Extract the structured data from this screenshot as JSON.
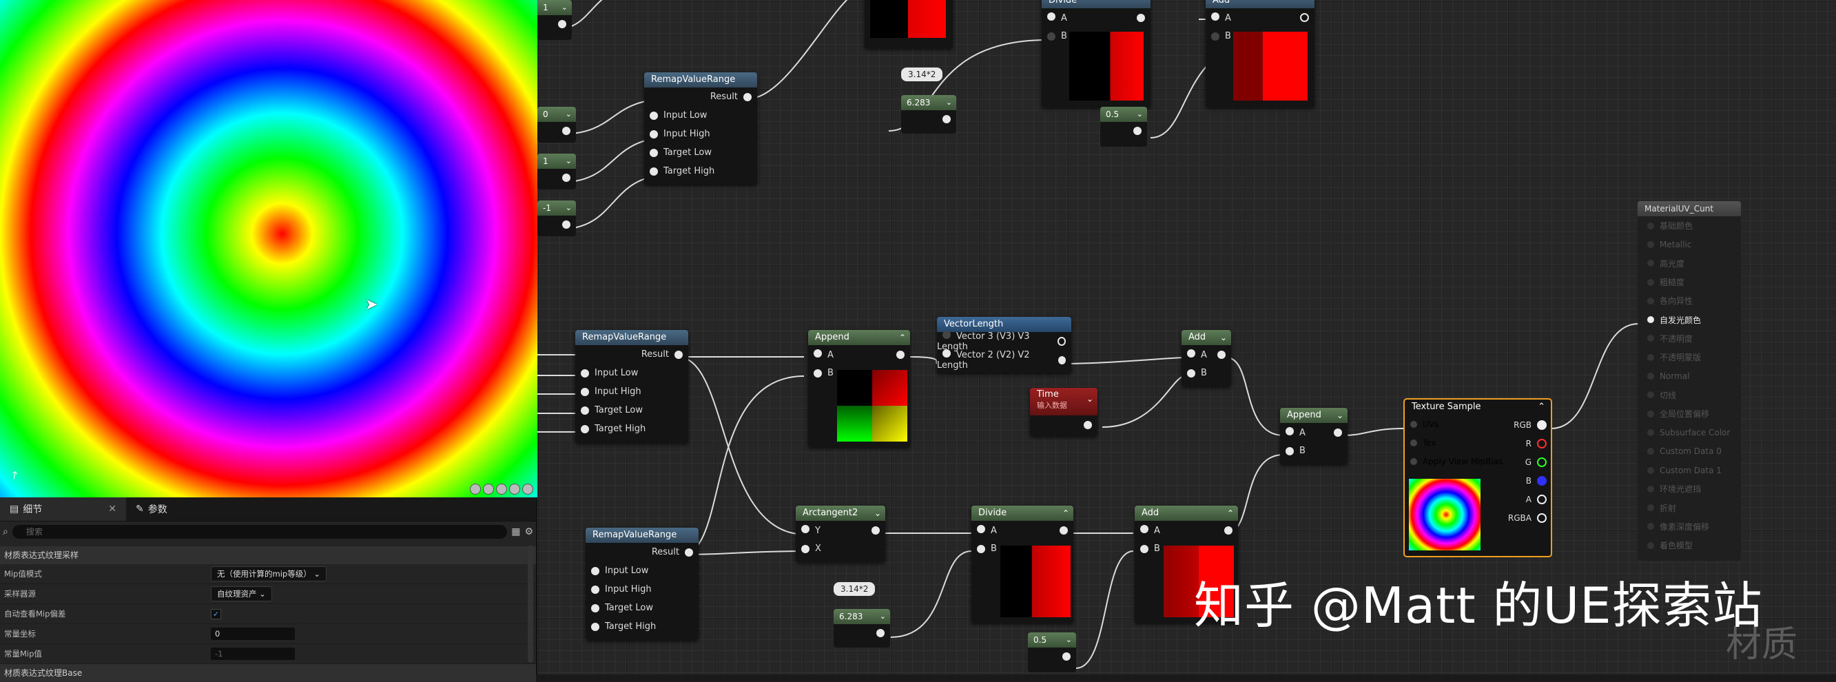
{
  "details_panel": {
    "tab_details": "细节",
    "tab_params": "参数",
    "search_placeholder": "搜索",
    "category_1": "材质表达式纹理采样",
    "rows": [
      {
        "label": "Mip值模式",
        "value": "无（使用计算的mip等级）"
      },
      {
        "label": "采样器源",
        "value": "自纹理资产"
      },
      {
        "label": "自动查看Mip偏差",
        "value": "✓"
      },
      {
        "label": "常量坐标",
        "value": "0"
      },
      {
        "label": "常量Mip值",
        "value": "-1"
      }
    ],
    "category_2": "材质表达式纹理Base"
  },
  "graph": {
    "top_nodes": {
      "remap1_title": "RemapValueRange",
      "divide_top_title": "Divide",
      "add_top_title": "Add",
      "bubble_top": "3.14*2",
      "const_top_6283": "6.283",
      "const_top_05": "0.5"
    },
    "consts_left": [
      "1",
      "0",
      "1",
      "-1"
    ],
    "remap_pins": {
      "result": "Result",
      "input_low": "Input Low",
      "input_high": "Input High",
      "target_low": "Target Low",
      "target_high": "Target High"
    },
    "remap2_title": "RemapValueRange",
    "remap3_title": "RemapValueRange",
    "append1": {
      "title": "Append",
      "a": "A",
      "b": "B"
    },
    "vector_length": {
      "title": "VectorLength",
      "pin1": "Vector 3 (V3) V3 Length",
      "pin2": "Vector 2 (V2) V2 Length"
    },
    "add_mid": {
      "title": "Add",
      "a": "A",
      "b": "B"
    },
    "time": {
      "title": "Time",
      "subtitle": "输入数据"
    },
    "append2": {
      "title": "Append",
      "a": "A",
      "b": "B"
    },
    "arctangent": {
      "title": "Arctangent2",
      "y": "Y",
      "x": "X"
    },
    "divide_bottom": {
      "title": "Divide",
      "a": "A",
      "b": "B"
    },
    "add_bottom": {
      "title": "Add",
      "a": "A",
      "b": "B"
    },
    "bubble_bottom": "3.14*2",
    "const_bottom_6283": "6.283",
    "const_bottom_05": "0.5",
    "texture_sample": {
      "title": "Texture Sample",
      "uvs": "UVs",
      "tex": "Tex",
      "mipbias": "Apply View MipBias",
      "rgb": "RGB",
      "r": "R",
      "g": "G",
      "b": "B",
      "a": "A",
      "rgba": "RGBA"
    },
    "material_node": {
      "title": "MaterialUV_Cunt",
      "pins": [
        "基础颜色",
        "Metallic",
        "高光度",
        "粗糙度",
        "各向异性",
        "自发光颜色",
        "不透明度",
        "不透明蒙版",
        "Normal",
        "切线",
        "全局位置偏移",
        "Subsurface Color",
        "Custom Data 0",
        "Custom Data 1",
        "环境光遮挡",
        "折射",
        "像素深度偏移",
        "着色模型"
      ],
      "active_pin": "自发光颜色"
    }
  },
  "watermark": "知乎 @Matt 的UE探索站",
  "corner_label": "材质",
  "colors": {
    "selection": "#f0a020",
    "node_header_blue": "#3e6a9a",
    "const_green": "#5e7c58",
    "time_red": "#9a2020"
  }
}
